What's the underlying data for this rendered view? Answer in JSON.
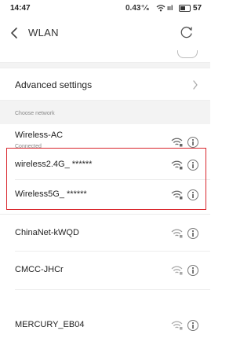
{
  "status_bar": {
    "time": "14:47",
    "speed": "0.43⁺⁄ₛ",
    "signal_label": "ııl",
    "battery": "57",
    "battery_level": 0.57
  },
  "header": {
    "title": "WLAN",
    "back_icon": "chevron-left-icon",
    "refresh_icon": "refresh-icon"
  },
  "advanced": {
    "label": "Advanced settings",
    "chevron_icon": "chevron-right-icon"
  },
  "section": {
    "label": "Choose network"
  },
  "networks": [
    {
      "name": "Wireless-AC",
      "status": "Connected"
    },
    {
      "name": "wireless2.4G_ ******",
      "status": ""
    },
    {
      "name": "Wireless5G_ ******",
      "status": ""
    },
    {
      "name": "ChinaNet-kWQD",
      "status": ""
    },
    {
      "name": "CMCC-JHCr",
      "status": ""
    },
    {
      "name": "MERCURY_EB04",
      "status": ""
    }
  ],
  "colors": {
    "highlight": "#d9262c",
    "text": "#222222",
    "secondary_text": "#888888",
    "background": "#ffffff"
  }
}
